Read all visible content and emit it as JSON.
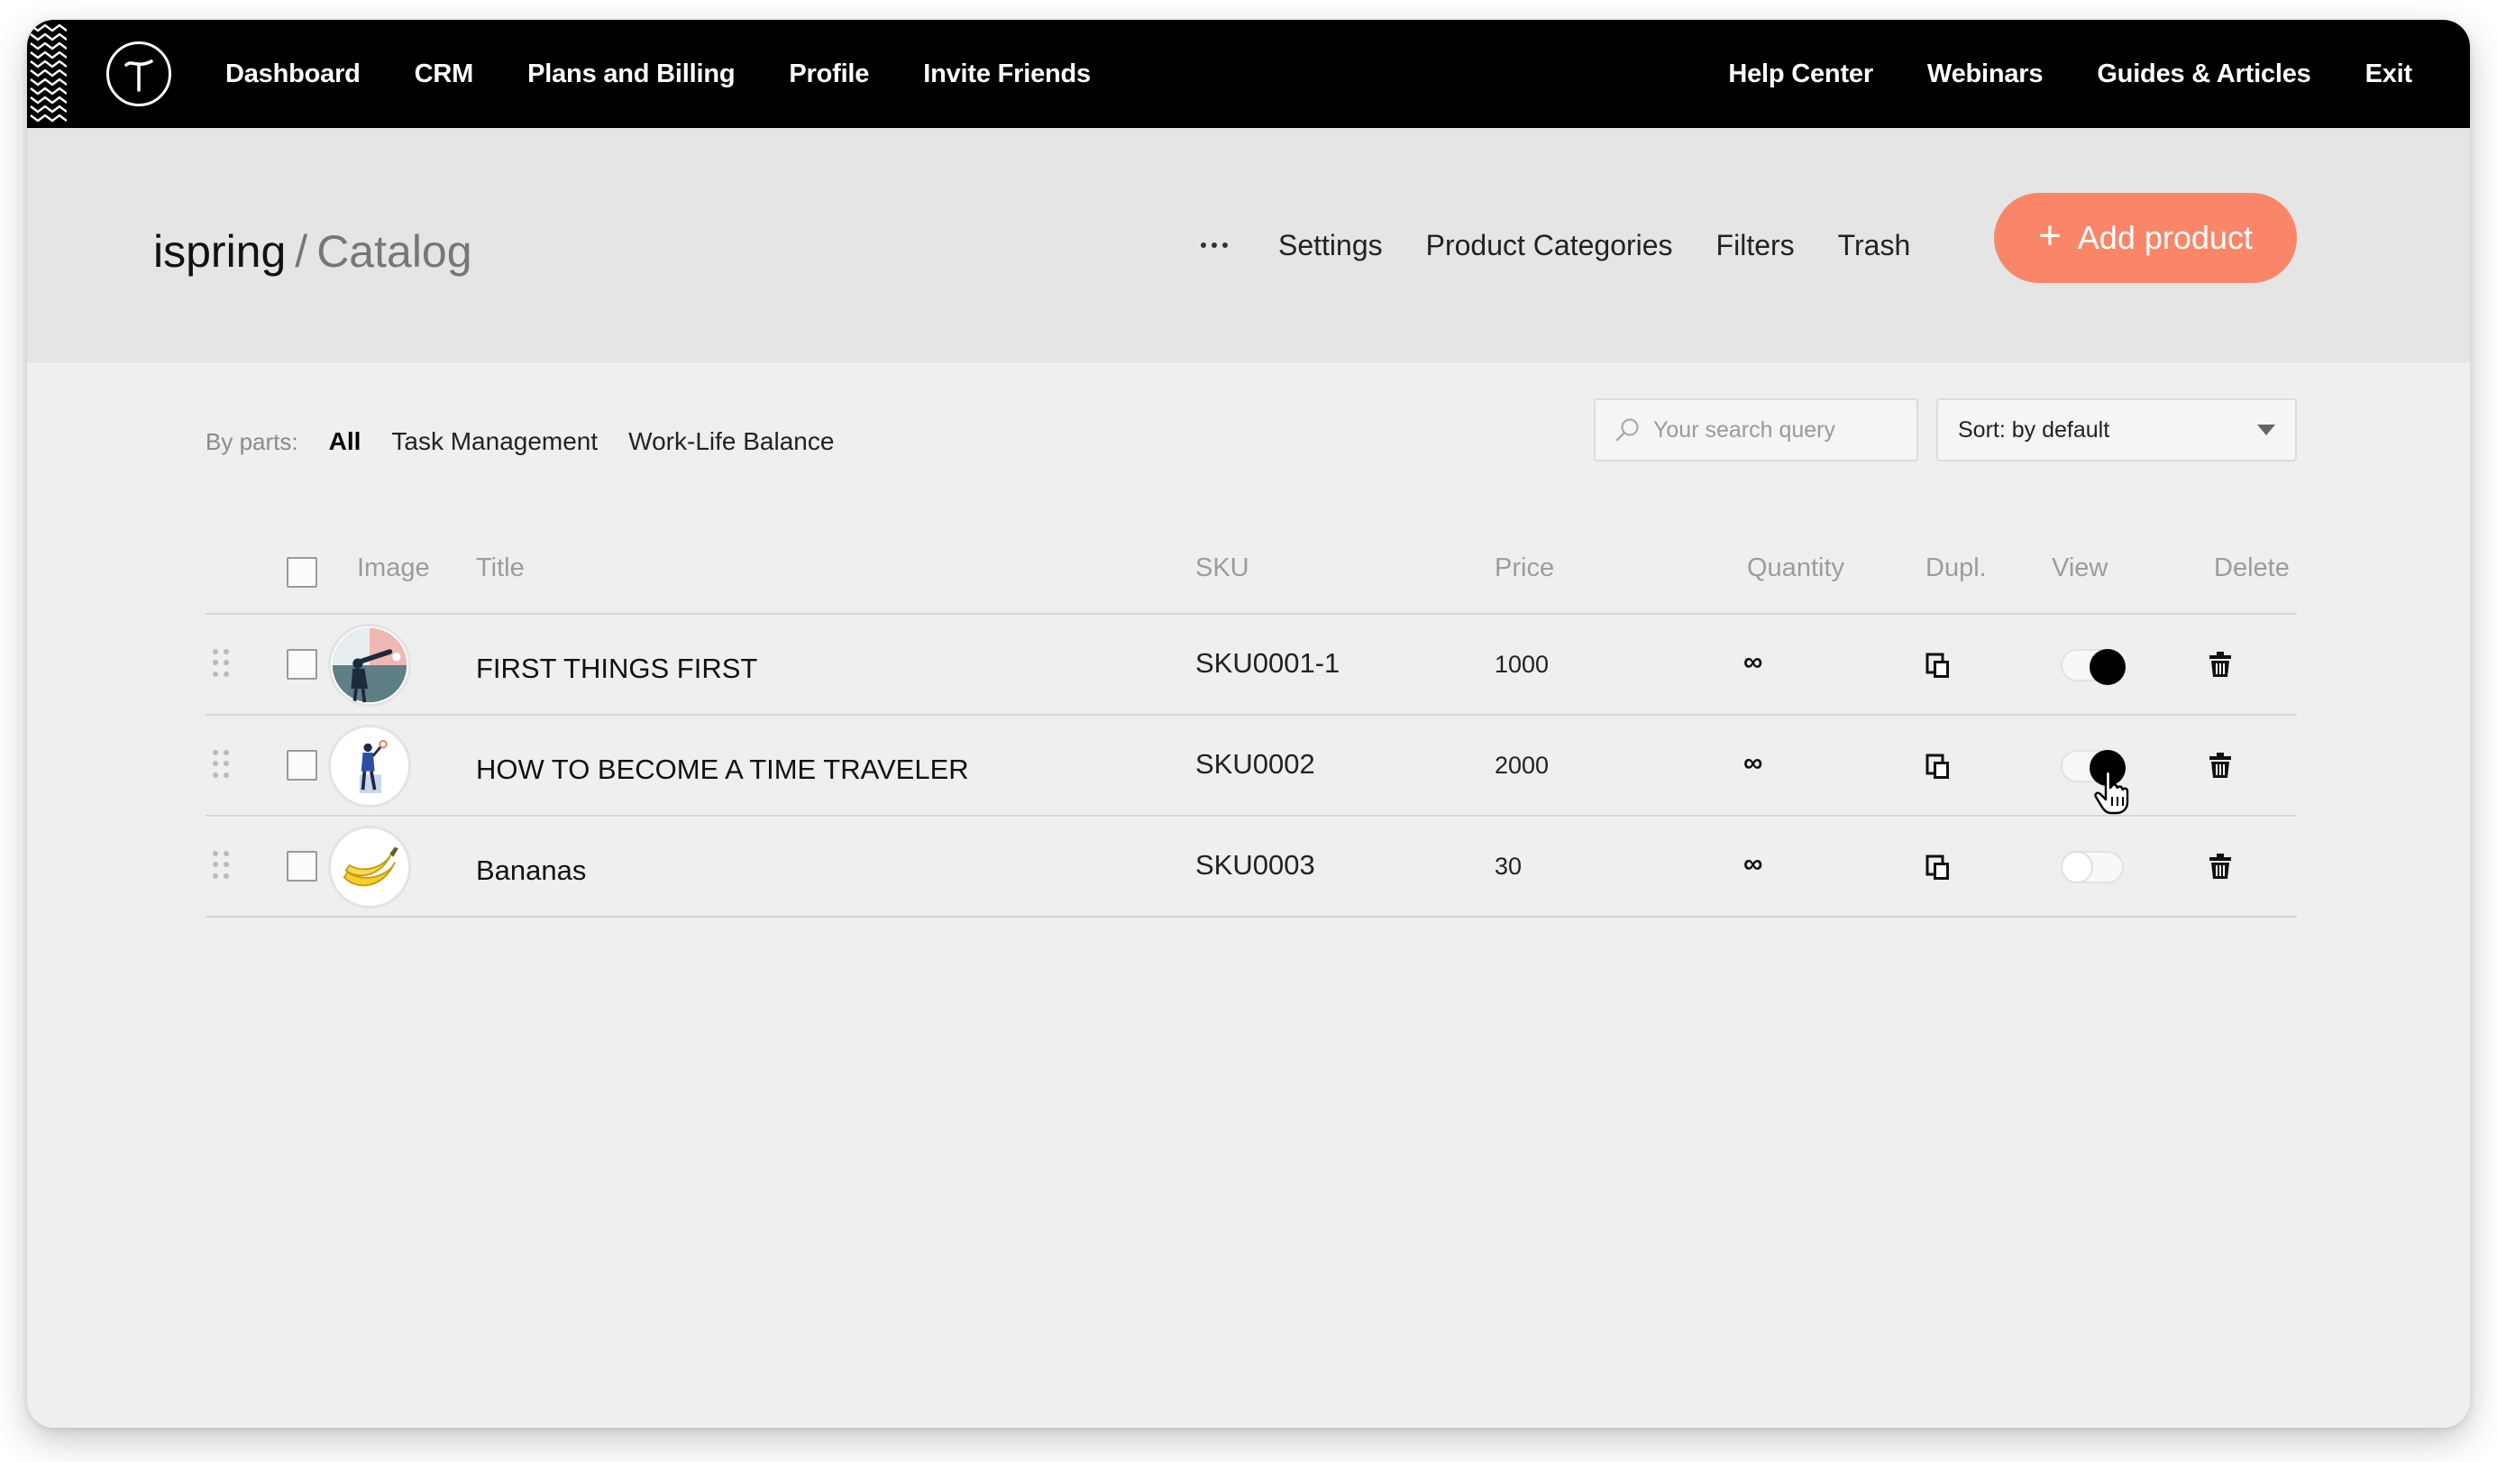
{
  "nav": {
    "left": [
      "Dashboard",
      "CRM",
      "Plans and Billing",
      "Profile",
      "Invite Friends"
    ],
    "right": [
      "Help Center",
      "Webinars",
      "Guides & Articles",
      "Exit"
    ]
  },
  "header": {
    "project": "ispring",
    "separator": "/",
    "page": "Catalog",
    "menu": [
      "Settings",
      "Product Categories",
      "Filters",
      "Trash"
    ],
    "add_button": "Add product",
    "add_icon": "+",
    "accent_color": "#fa8669"
  },
  "filters": {
    "label": "By parts:",
    "items": [
      "All",
      "Task Management",
      "Work-Life Balance"
    ],
    "active": "All"
  },
  "search": {
    "placeholder": "Your search query",
    "value": ""
  },
  "sort": {
    "label": "Sort: by default"
  },
  "table": {
    "columns": [
      "Image",
      "Title",
      "SKU",
      "Price",
      "Quantity",
      "Dupl.",
      "View",
      "Delete"
    ],
    "rows": [
      {
        "title": "FIRST THINGS FIRST",
        "sku": "SKU0001-1",
        "price": "1000",
        "quantity": "∞",
        "view": true,
        "image": "telescope-person-icon"
      },
      {
        "title": "HOW TO BECOME A TIME TRAVELER",
        "sku": "SKU0002",
        "price": "2000",
        "quantity": "∞",
        "view": true,
        "image": "time-traveler-icon"
      },
      {
        "title": "Bananas",
        "sku": "SKU0003",
        "price": "30",
        "quantity": "∞",
        "view": false,
        "image": "banana-icon"
      }
    ]
  }
}
